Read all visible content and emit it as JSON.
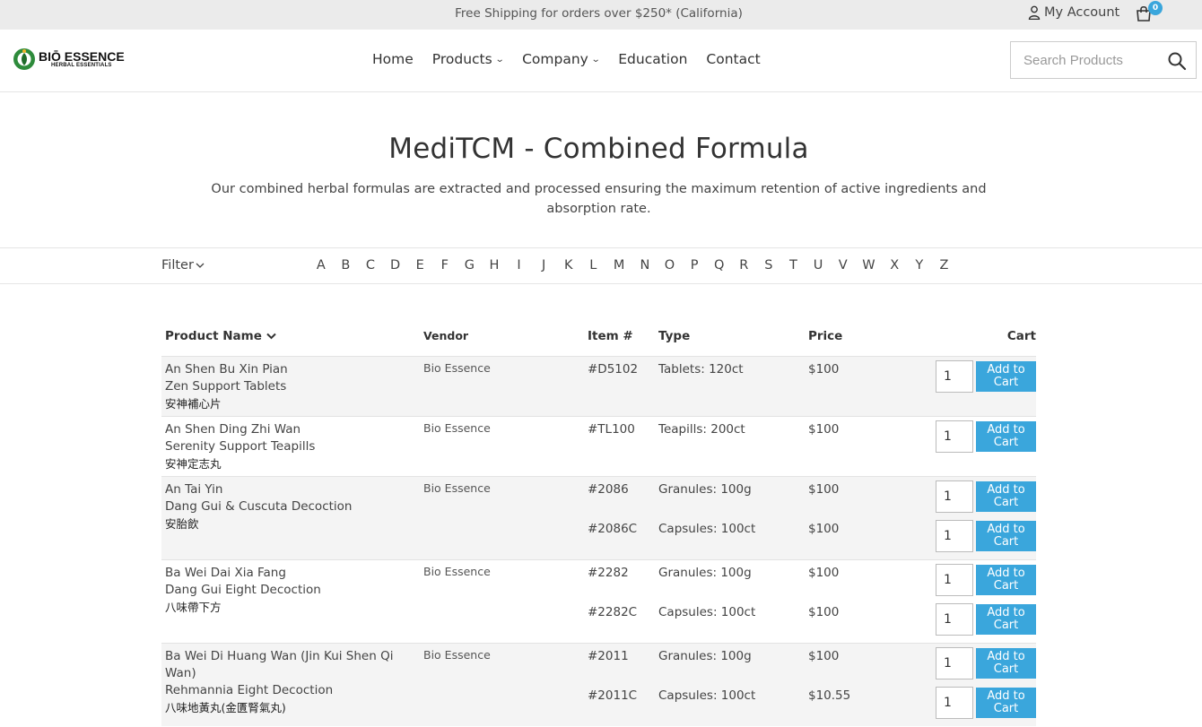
{
  "topbar": {
    "shipping": "Free Shipping for orders over $250* (California)",
    "account_label": "My Account",
    "cart_count": "0"
  },
  "logo": {
    "brand": "BIŌ ESSENCE",
    "sub": "HERBAL ESSENTIALS",
    "accent": "#2e8b3b"
  },
  "nav": {
    "home": "Home",
    "products": "Products",
    "company": "Company",
    "education": "Education",
    "contact": "Contact"
  },
  "search": {
    "placeholder": "Search Products"
  },
  "hero": {
    "title": "MediTCM - Combined Formula",
    "description": "Our combined herbal formulas are extracted and processed ensuring the maximum retention of active ingredients and absorption rate."
  },
  "filter": {
    "label": "Filter",
    "letters": [
      "A",
      "B",
      "C",
      "D",
      "E",
      "F",
      "G",
      "H",
      "I",
      "J",
      "K",
      "L",
      "M",
      "N",
      "O",
      "P",
      "Q",
      "R",
      "S",
      "T",
      "U",
      "V",
      "W",
      "X",
      "Y",
      "Z"
    ]
  },
  "table": {
    "headers": {
      "name": "Product Name",
      "vendor": "Vendor",
      "item": "Item #",
      "type": "Type",
      "price": "Price",
      "cart": "Cart"
    },
    "add_label_1": "Add to",
    "add_label_2": "Cart",
    "products": [
      {
        "name": "An Shen Bu Xin Pian",
        "english": "Zen Support Tablets",
        "chinese": "安神補心片",
        "vendor": "Bio Essence",
        "variants": [
          {
            "item": "#D5102",
            "type": "Tablets: 120ct",
            "price": "$100",
            "qty": "1"
          }
        ]
      },
      {
        "name": "An Shen Ding Zhi Wan",
        "english": "Serenity Support Teapills",
        "chinese": "安神定志丸",
        "vendor": "Bio Essence",
        "variants": [
          {
            "item": "#TL100",
            "type": "Teapills: 200ct",
            "price": "$100",
            "qty": "1"
          }
        ]
      },
      {
        "name": "An Tai Yin",
        "english": "Dang Gui & Cuscuta Decoction",
        "chinese": "安胎飲",
        "vendor": "Bio Essence",
        "variants": [
          {
            "item": "#2086",
            "type": "Granules: 100g",
            "price": "$100",
            "qty": "1"
          },
          {
            "item": "#2086C",
            "type": "Capsules: 100ct",
            "price": "$100",
            "qty": "1"
          }
        ]
      },
      {
        "name": "Ba Wei Dai Xia Fang",
        "english": "Dang Gui Eight Decoction",
        "chinese": "八味帶下方",
        "vendor": "Bio Essence",
        "variants": [
          {
            "item": "#2282",
            "type": "Granules: 100g",
            "price": "$100",
            "qty": "1"
          },
          {
            "item": "#2282C",
            "type": "Capsules: 100ct",
            "price": "$100",
            "qty": "1"
          }
        ]
      },
      {
        "name": "Ba Wei Di Huang Wan (Jin Kui Shen Qi Wan)",
        "english": "Rehmannia Eight Decoction",
        "chinese": "八味地黃丸(金匱腎氣丸)",
        "vendor": "Bio Essence",
        "variants": [
          {
            "item": "#2011",
            "type": "Granules: 100g",
            "price": "$100",
            "qty": "1"
          },
          {
            "item": "#2011C",
            "type": "Capsules: 100ct",
            "price": "$10.55",
            "qty": "1"
          }
        ]
      }
    ]
  },
  "colors": {
    "accent": "#3aa6dc",
    "topbar_bg": "#ebebeb",
    "row_shade": "#f4f4f4"
  }
}
